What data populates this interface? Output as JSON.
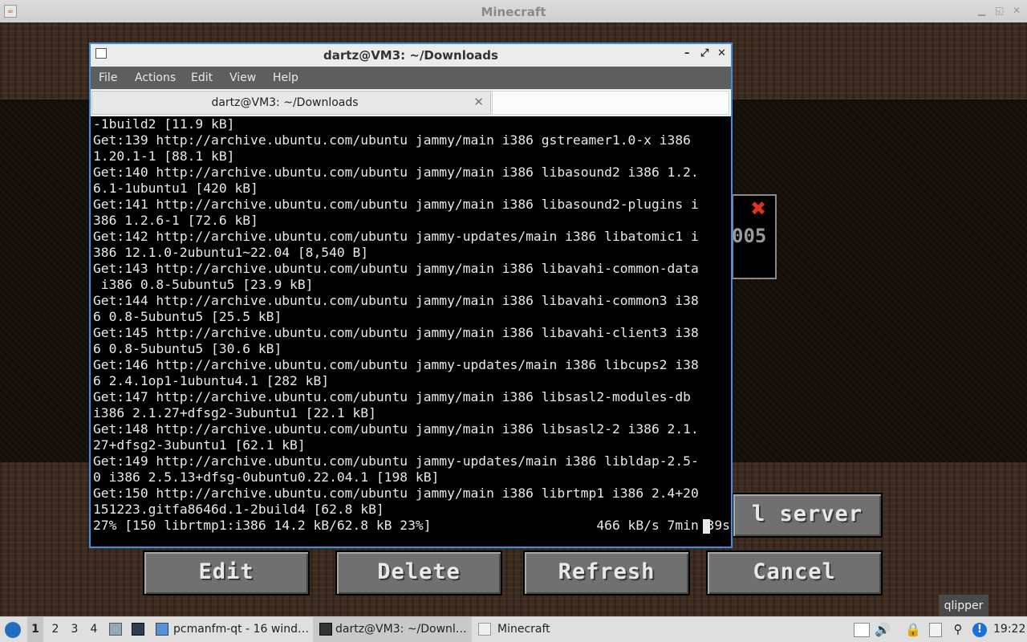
{
  "window": {
    "title": "Minecraft"
  },
  "minecraft": {
    "buttons": {
      "edit": "Edit",
      "delete": "Delete",
      "refresh": "Refresh",
      "cancel": "Cancel",
      "add_server_partial": "l server"
    },
    "server_count_partial": "005"
  },
  "terminal": {
    "title": "dartz@VM3: ~/Downloads",
    "menu": [
      "File",
      "Actions",
      "Edit",
      "View",
      "Help"
    ],
    "tab_label": "dartz@VM3: ~/Downloads",
    "lines": [
      "-1build2 [11.9 kB]",
      "Get:139 http://archive.ubuntu.com/ubuntu jammy/main i386 gstreamer1.0-x i386",
      "1.20.1-1 [88.1 kB]",
      "Get:140 http://archive.ubuntu.com/ubuntu jammy/main i386 libasound2 i386 1.2.",
      "6.1-1ubuntu1 [420 kB]",
      "Get:141 http://archive.ubuntu.com/ubuntu jammy/main i386 libasound2-plugins i",
      "386 1.2.6-1 [72.6 kB]",
      "Get:142 http://archive.ubuntu.com/ubuntu jammy-updates/main i386 libatomic1 i",
      "386 12.1.0-2ubuntu1~22.04 [8,540 B]",
      "Get:143 http://archive.ubuntu.com/ubuntu jammy/main i386 libavahi-common-data",
      " i386 0.8-5ubuntu5 [23.9 kB]",
      "Get:144 http://archive.ubuntu.com/ubuntu jammy/main i386 libavahi-common3 i38",
      "6 0.8-5ubuntu5 [25.5 kB]",
      "Get:145 http://archive.ubuntu.com/ubuntu jammy/main i386 libavahi-client3 i38",
      "6 0.8-5ubuntu5 [30.6 kB]",
      "Get:146 http://archive.ubuntu.com/ubuntu jammy-updates/main i386 libcups2 i38",
      "6 2.4.1op1-1ubuntu4.1 [282 kB]",
      "Get:147 http://archive.ubuntu.com/ubuntu jammy/main i386 libsasl2-modules-db",
      "i386 2.1.27+dfsg2-3ubuntu1 [22.1 kB]",
      "Get:148 http://archive.ubuntu.com/ubuntu jammy/main i386 libsasl2-2 i386 2.1.",
      "27+dfsg2-3ubuntu1 [62.1 kB]",
      "Get:149 http://archive.ubuntu.com/ubuntu jammy-updates/main i386 libldap-2.5-",
      "0 i386 2.5.13+dfsg-0ubuntu0.22.04.1 [198 kB]",
      "Get:150 http://archive.ubuntu.com/ubuntu jammy/main i386 librtmp1 i386 2.4+20",
      "151223.gitfa8646d.1-2build4 [62.8 kB]",
      "27% [150 librtmp1:i386 14.2 kB/62.8 kB 23%]                     466 kB/s 7min 39s"
    ]
  },
  "taskbar": {
    "workspaces": [
      "1",
      "2",
      "3",
      "4"
    ],
    "tasks": [
      {
        "label": "pcmanfm-qt - 16 wind…",
        "icon": "folder-icon"
      },
      {
        "label": "dartz@VM3: ~/Downl…",
        "icon": "terminal-icon"
      },
      {
        "label": "Minecraft",
        "icon": "java-icon"
      }
    ],
    "clock": "19:22",
    "tooltip": "qlipper"
  },
  "colors": {
    "accent": "#3d8ee6",
    "terminal_bg": "#000000",
    "terminal_fg": "#e8e8e8"
  }
}
